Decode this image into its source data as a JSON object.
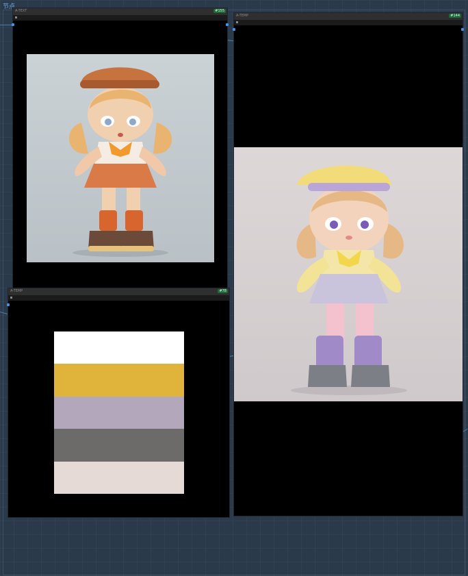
{
  "canvas": {
    "top_label": "节点"
  },
  "nodes": [
    {
      "title": "A-TEXT",
      "id": "#155",
      "image": "figure-orange-outfit"
    },
    {
      "title": "A-TEMP",
      "id": "#144",
      "image": "figure-yellow-purple-outfit"
    },
    {
      "title": "A-TEMP",
      "id": "#78",
      "image": "color-palette"
    }
  ],
  "palette": {
    "colors": [
      "#ffffff",
      "#e0b43a",
      "#b3a7bb",
      "#6c6b69",
      "#e5dad5"
    ]
  }
}
